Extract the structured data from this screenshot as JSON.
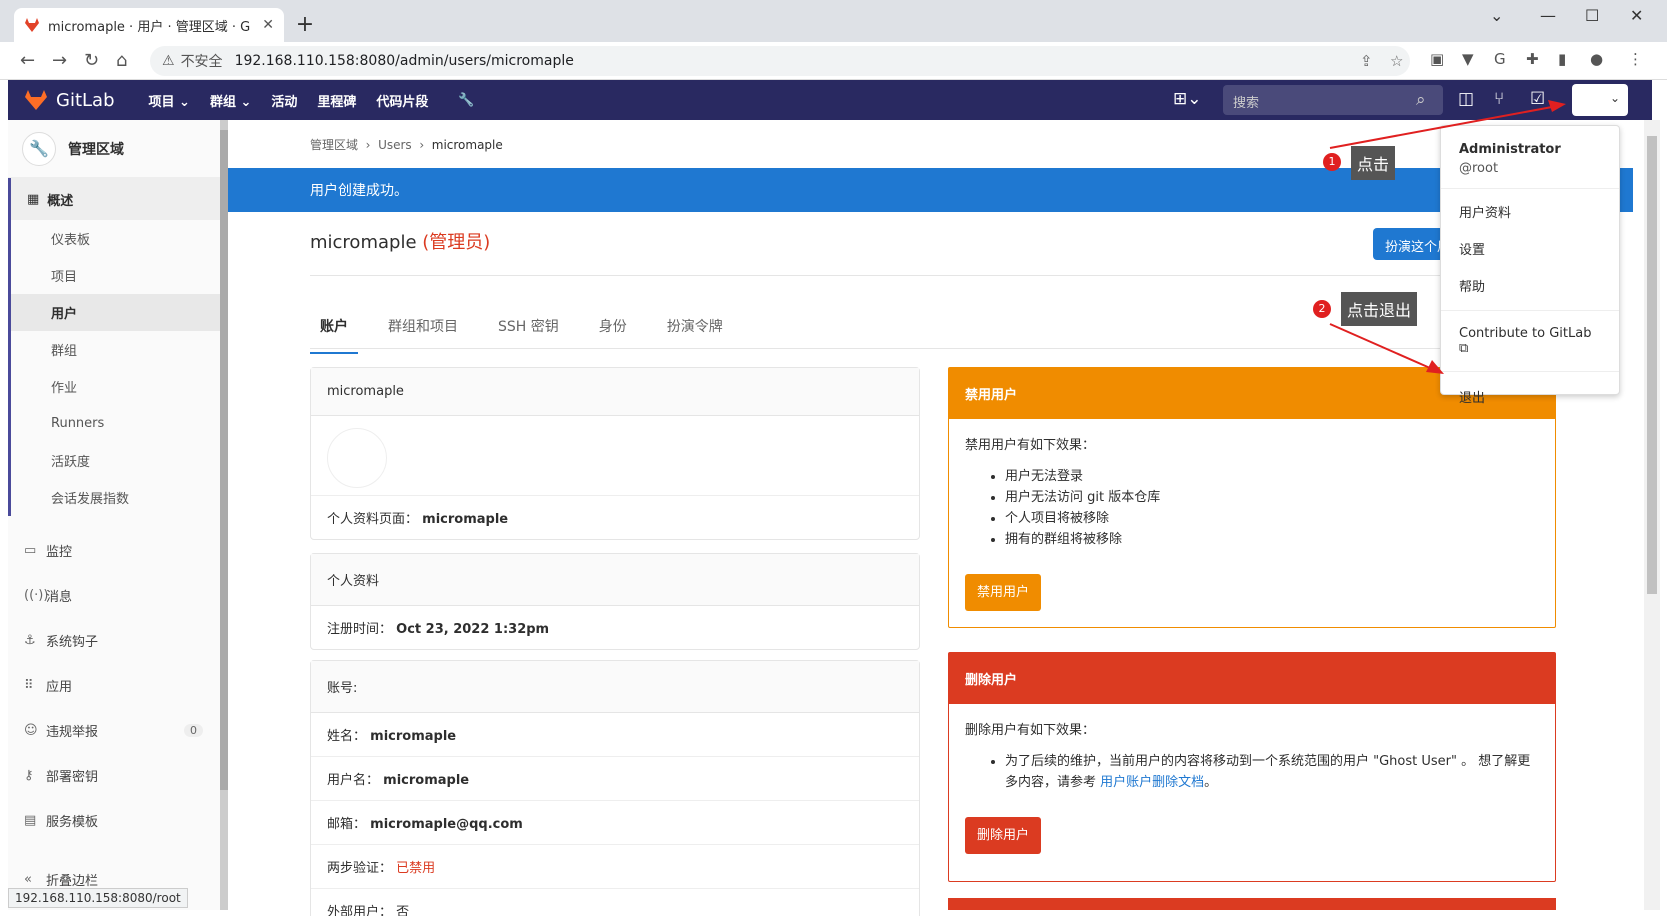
{
  "browser": {
    "tab_title": "micromaple · 用户 · 管理区域 · G",
    "security_label": "不安全",
    "url": "192.168.110.158:8080/admin/users/micromaple",
    "status_url": "192.168.110.158:8080/root"
  },
  "navbar": {
    "brand": "GitLab",
    "items": [
      "项目",
      "群组",
      "活动",
      "里程碑",
      "代码片段"
    ],
    "search_placeholder": "搜索"
  },
  "sidebar": {
    "title": "管理区域",
    "overview": "概述",
    "sub": [
      "仪表板",
      "项目",
      "用户",
      "群组",
      "作业",
      "Runners",
      "活跃度",
      "会话发展指数"
    ],
    "items": [
      {
        "label": "监控",
        "icon": "monitor-icon"
      },
      {
        "label": "消息",
        "icon": "broadcast-icon"
      },
      {
        "label": "系统钩子",
        "icon": "hook-icon"
      },
      {
        "label": "应用",
        "icon": "apps-icon"
      },
      {
        "label": "违规举报",
        "icon": "abuse-icon",
        "badge": "0"
      },
      {
        "label": "部署密钥",
        "icon": "key-icon"
      },
      {
        "label": "服务模板",
        "icon": "template-icon"
      }
    ],
    "collapse": "折叠边栏"
  },
  "breadcrumb": [
    "管理区域",
    "Users",
    "micromaple"
  ],
  "flash": "用户创建成功。",
  "user": {
    "name": "micromaple",
    "admin_tag": "(管理员)",
    "impersonate": "扮演这个用户"
  },
  "tabs": [
    "账户",
    "群组和项目",
    "SSH 密钥",
    "身份",
    "扮演令牌"
  ],
  "card1": {
    "header": "micromaple",
    "profile_label": "个人资料页面：",
    "profile_value": "micromaple"
  },
  "card2": {
    "header": "个人资料",
    "reg_label": "注册时间：",
    "reg_value": "Oct 23, 2022 1:32pm"
  },
  "card3": {
    "header": "账号:",
    "rows": [
      {
        "label": "姓名：",
        "value": "micromaple"
      },
      {
        "label": "用户名：",
        "value": "micromaple"
      },
      {
        "label": "邮箱：",
        "value": "micromaple@qq.com"
      },
      {
        "label": "两步验证：",
        "value": "已禁用"
      },
      {
        "label": "外部用户：",
        "value": "否"
      }
    ]
  },
  "block": {
    "header": "禁用用户",
    "intro": "禁用用户有如下效果：",
    "effects": [
      "用户无法登录",
      "用户无法访问 git 版本仓库",
      "个人项目将被移除",
      "拥有的群组将被移除"
    ],
    "button": "禁用用户",
    "color": "#f08c00"
  },
  "delete": {
    "header": "删除用户",
    "intro": "删除用户有如下效果：",
    "text": "为了后续的维护，当前用户的内容将移动到一个系统范围的用户 \"Ghost User\" 。 想了解更多内容，请参考 ",
    "link": "用户账户删除文档",
    "tail": "。",
    "button": "删除用户",
    "color": "#db3b21"
  },
  "dropdown": {
    "name": "Administrator",
    "handle": "@root",
    "items": [
      "用户资料",
      "设置",
      "帮助"
    ],
    "contribute": "Contribute to GitLab",
    "signout": "退出"
  },
  "annotations": {
    "a1_num": "1",
    "a1_text": "点击",
    "a2_num": "2",
    "a2_text": "点击退出"
  }
}
